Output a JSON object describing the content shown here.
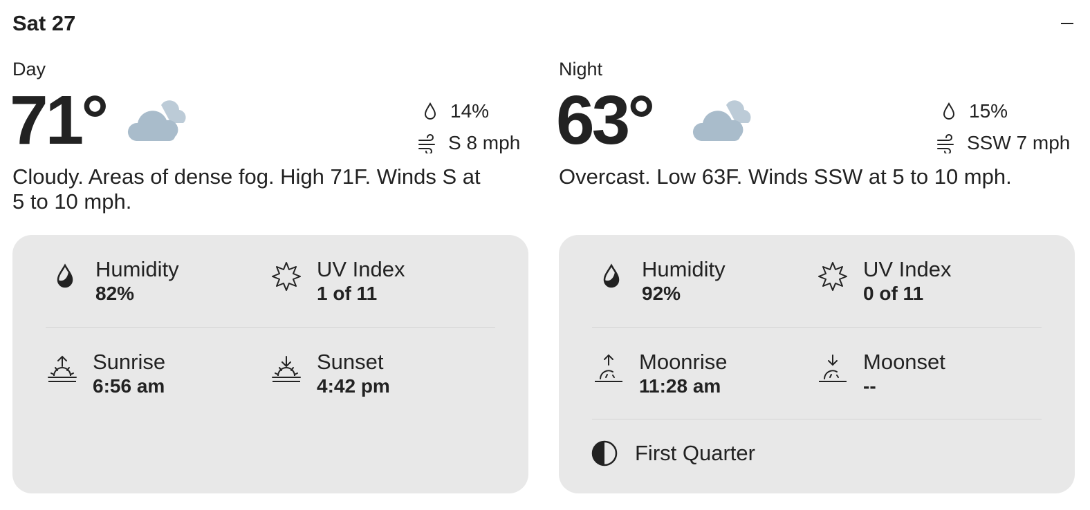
{
  "header": {
    "date": "Sat 27"
  },
  "day": {
    "label": "Day",
    "temp": "71°",
    "condition_icon": "partly-cloudy-icon",
    "precip": "14%",
    "wind": "S 8 mph",
    "description": "Cloudy. Areas of dense fog. High 71F. Winds S at 5 to 10 mph.",
    "details": {
      "humidity_label": "Humidity",
      "humidity": "82%",
      "uv_label": "UV Index",
      "uv": "1 of 11",
      "sunrise_label": "Sunrise",
      "sunrise": "6:56 am",
      "sunset_label": "Sunset",
      "sunset": "4:42 pm"
    }
  },
  "night": {
    "label": "Night",
    "temp": "63°",
    "condition_icon": "partly-cloudy-icon",
    "precip": "15%",
    "wind": "SSW 7 mph",
    "description": "Overcast. Low 63F. Winds SSW at 5 to 10 mph.",
    "details": {
      "humidity_label": "Humidity",
      "humidity": "92%",
      "uv_label": "UV Index",
      "uv": "0 of 11",
      "moonrise_label": "Moonrise",
      "moonrise": "11:28 am",
      "moonset_label": "Moonset",
      "moonset": "--",
      "moon_phase": "First Quarter"
    }
  },
  "colors": {
    "panel": "#e8e8e8",
    "cloud": "#a9bccb",
    "text": "#222222"
  }
}
